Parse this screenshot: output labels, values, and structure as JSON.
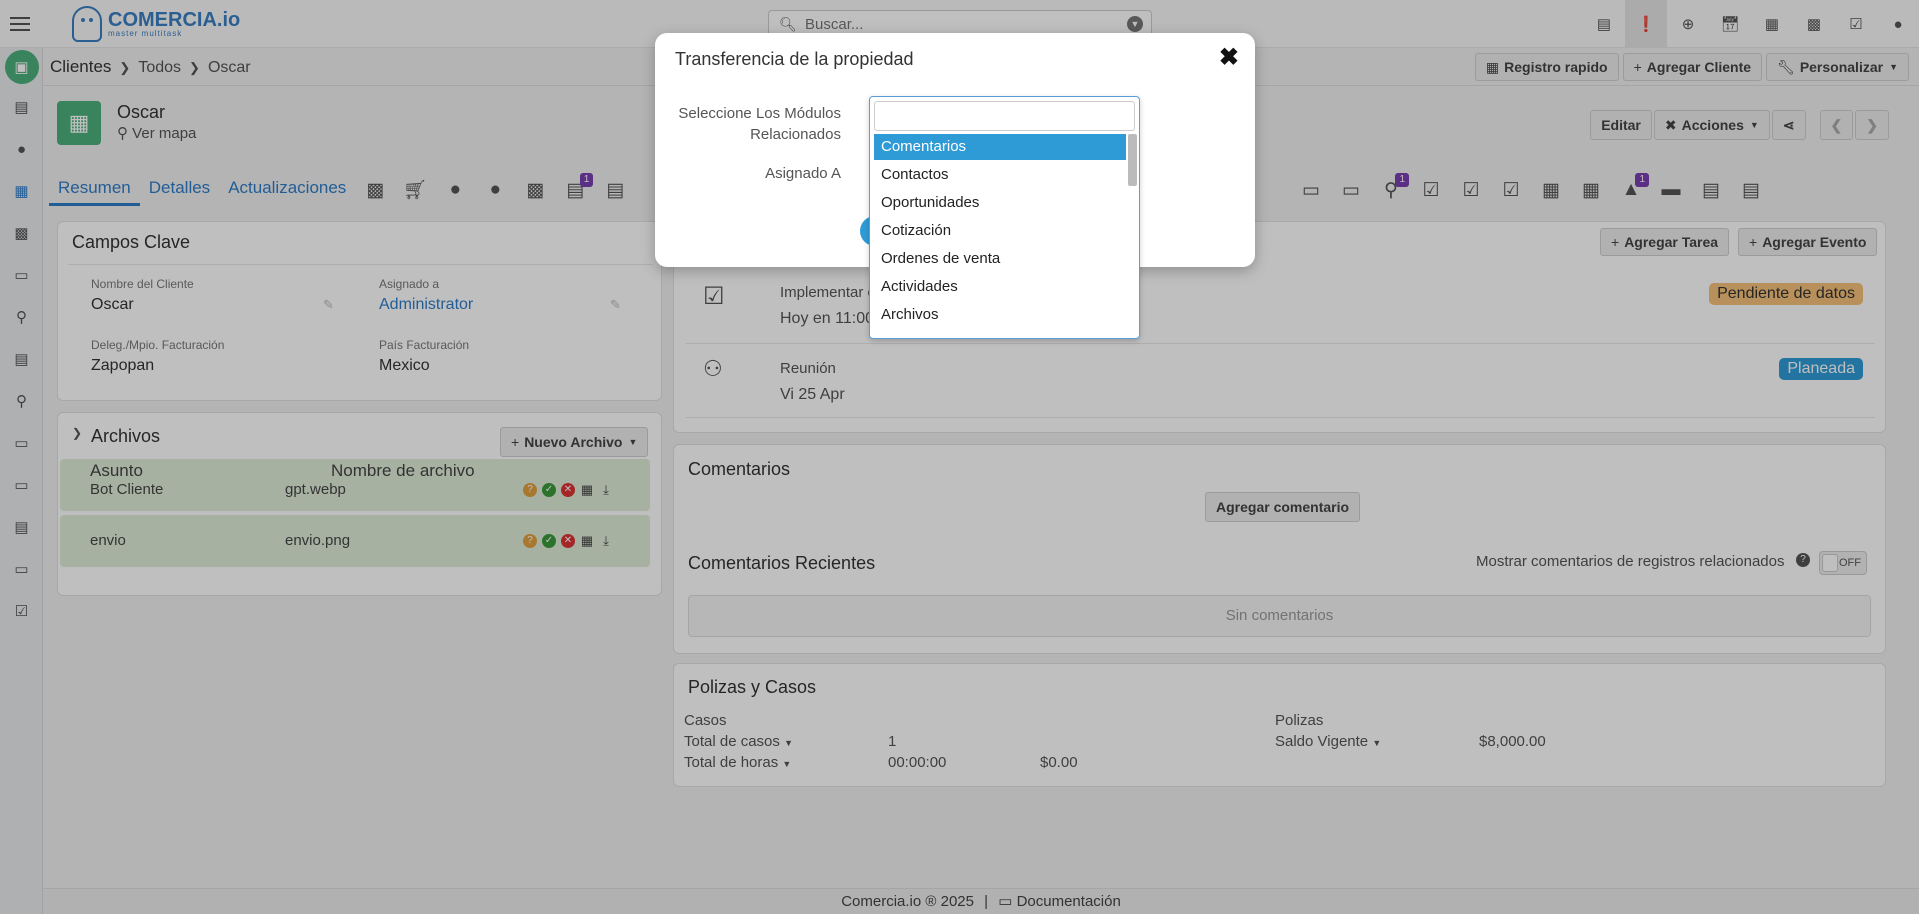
{
  "topbar": {
    "brand_name": "COMERCIA.io",
    "brand_tag": "master multitask",
    "search_placeholder": "Buscar...",
    "icons": [
      "inbox-icon",
      "alert-icon",
      "plus-circle-icon",
      "calendar-check-icon",
      "calendar-icon",
      "chart-icon",
      "checkbox-icon",
      "user-icon"
    ]
  },
  "breadcrumb": {
    "module": "Clientes",
    "filter": "Todos",
    "record": "Oscar"
  },
  "toolbar": {
    "quick_register": "Registro rapido",
    "add_client": "Agregar Cliente",
    "customize": "Personalizar"
  },
  "record": {
    "name": "Oscar",
    "map_link": "Ver mapa",
    "edit": "Editar",
    "actions": "Acciones"
  },
  "tabs": {
    "summary": "Resumen",
    "details": "Detalles",
    "updates": "Actualizaciones",
    "badge_count": "1"
  },
  "key_fields": {
    "title": "Campos Clave",
    "client_name_label": "Nombre del Cliente",
    "client_name": "Oscar",
    "assigned_label": "Asignado a",
    "assigned": "Administrator",
    "district_label": "Deleg./Mpio. Facturación",
    "district": "Zapopan",
    "country_label": "País Facturación",
    "country": "Mexico"
  },
  "files": {
    "title": "Archivos",
    "new_button": "Nuevo Archivo",
    "col_subject": "Asunto",
    "col_filename": "Nombre de archivo",
    "rows": [
      {
        "subject": "Bot Cliente",
        "filename": "gpt.webp"
      },
      {
        "subject": "envio",
        "filename": "envio.png"
      }
    ]
  },
  "activities": {
    "add_task": "Agregar Tarea",
    "add_event": "Agregar Evento",
    "items": [
      {
        "title": "Implementar c",
        "time": "Hoy en 11:00",
        "status": "Pendiente de datos"
      },
      {
        "title": "Reunión",
        "time": "Vi 25 Apr",
        "status": "Planeada"
      }
    ]
  },
  "comments": {
    "title": "Comentarios",
    "add_button": "Agregar comentario",
    "recent_title": "Comentarios Recientes",
    "show_related": "Mostrar comentarios de registros relacionados",
    "toggle_state": "OFF",
    "empty": "Sin comentarios"
  },
  "policies": {
    "title": "Polizas y Casos",
    "cases_label": "Casos",
    "total_cases_label": "Total de casos",
    "total_cases": "1",
    "total_hours_label": "Total de horas",
    "total_hours": "00:00:00",
    "hours_amount": "$0.00",
    "policies_label": "Polizas",
    "balance_label": "Saldo Vigente",
    "balance": "$8,000.00"
  },
  "footer": {
    "copyright": "Comercia.io ® 2025",
    "docs": "Documentación"
  },
  "modal": {
    "title": "Transferencia de la propiedad",
    "modules_label_line1": "Seleccione Los Módulos",
    "modules_label_line2": "Relacionados",
    "assigned_label": "Asignado A",
    "options": [
      "Comentarios",
      "Contactos",
      "Oportunidades",
      "Cotización",
      "Ordenes de venta",
      "Actividades",
      "Archivos"
    ],
    "selected_option": "Comentarios"
  },
  "colors": {
    "accent": "#2f7dc9",
    "brand_green": "#4caf7d",
    "badge_purple": "#7b3fb5",
    "status_orange": "#f5c07a",
    "status_blue": "#2f9bd6"
  }
}
